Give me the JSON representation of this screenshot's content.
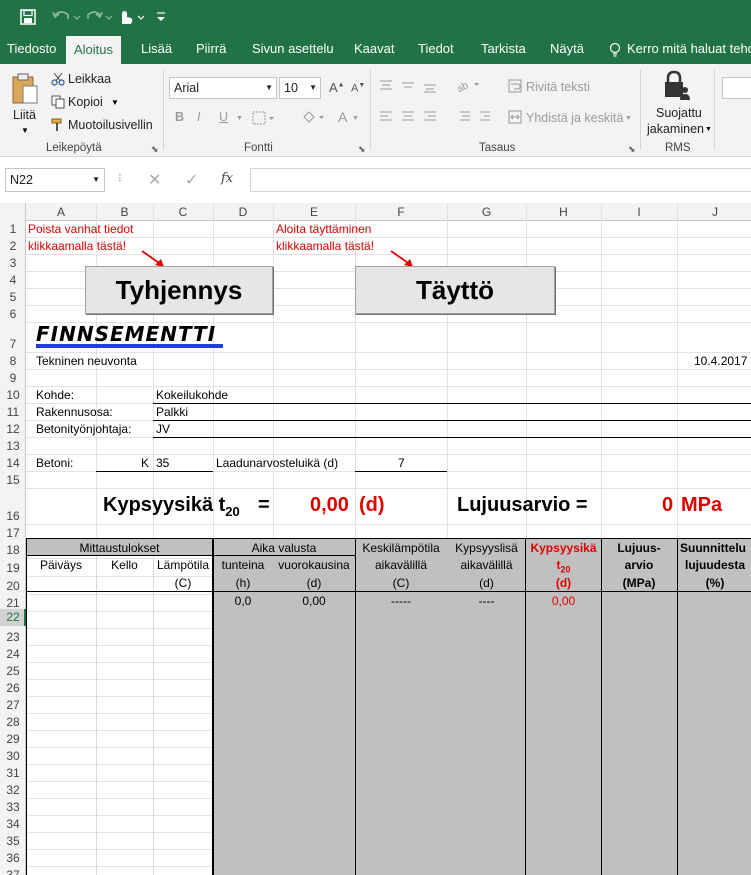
{
  "qat": {
    "save_icon": "save-icon",
    "undo_icon": "undo-icon",
    "redo_icon": "redo-icon",
    "touch_icon": "touch-mode-icon",
    "customize_icon": "customize-qat-icon"
  },
  "tabs": [
    "Tiedosto",
    "Aloitus",
    "Lisää",
    "Piirrä",
    "Sivun asettelu",
    "Kaavat",
    "Tiedot",
    "Tarkista",
    "Näytä",
    "Kerro mitä haluat tehdä"
  ],
  "ribbon": {
    "clipboard": {
      "paste": "Liitä",
      "cut": "Leikkaa",
      "copy": "Kopioi",
      "format_painter": "Muotoilusivellin",
      "group": "Leikepöytä"
    },
    "font": {
      "name": "Arial",
      "size": "10",
      "group": "Fontti",
      "bold": "B",
      "italic": "I",
      "underline": "U"
    },
    "alignment": {
      "wrap": "Rivitä teksti",
      "merge": "Yhdistä ja keskitä",
      "group": "Tasaus"
    },
    "rms": {
      "protect_line1": "Suojattu",
      "protect_line2": "jakaminen",
      "group": "RMS"
    }
  },
  "formula_bar": {
    "name_box": "N22",
    "fx": "fx",
    "cancel": "✕",
    "enter": "✓",
    "formula": ""
  },
  "columns": [
    "A",
    "B",
    "C",
    "D",
    "E",
    "F",
    "G",
    "H",
    "I",
    "J"
  ],
  "rows": [
    "1",
    "2",
    "3",
    "4",
    "5",
    "6",
    "7",
    "8",
    "9",
    "10",
    "11",
    "12",
    "13",
    "14",
    "15",
    "16",
    "17",
    "18",
    "19",
    "20",
    "21",
    "22",
    "23",
    "24",
    "25",
    "26",
    "27",
    "28",
    "29",
    "30",
    "31",
    "32",
    "33",
    "34",
    "35",
    "36",
    "37"
  ],
  "sheet": {
    "note1_l1": "Poista vanhat tiedot",
    "note1_l2": "klikkaamalla tästä!",
    "note2_l1": "Aloita täyttäminen",
    "note2_l2": "klikkaamalla tästä!",
    "btn_clear": "Tyhjennys",
    "btn_fill": "Täyttö",
    "logo": "FINNSEMENTTI",
    "dept": "Tekninen neuvonta",
    "date": "10.4.2017",
    "kohde_label": "Kohde:",
    "kohde_value": "Kokeilukohde",
    "rakennusosa_label": "Rakennusosa:",
    "rakennusosa_value": "Palkki",
    "johtaja_label": "Betonityönjohtaja:",
    "johtaja_value": "JV",
    "betoni_label": "Betoni:",
    "betoni_k": "K",
    "betoni_value": "35",
    "laatu_label": "Laadunarvosteluikä (d)",
    "laatu_value": "7",
    "kyps_label": "Kypsyysikä t",
    "kyps_sub": "20",
    "kyps_eq": "=",
    "kyps_value": "0,00",
    "kyps_unit": "(d)",
    "luj_label": "Lujuusarvio =",
    "luj_value": "0",
    "luj_unit": "MPa",
    "h_mittaus": "Mittaustulokset",
    "h_paivays": "Päiväys",
    "h_kello": "Kello",
    "h_lampotila": "Lämpötila",
    "h_c": "(C)",
    "h_aika": "Aika valusta",
    "h_tunteina": "tunteina",
    "h_h": "(h)",
    "h_vuoro": "vuorokausina",
    "h_d": "(d)",
    "h_keski1": "Keskilämpötila",
    "h_keski2": "aikavälillä",
    "h_keski3": "(C)",
    "h_lisa1": "Kypsyyslisä",
    "h_lisa2": "aikavälillä",
    "h_lisa3": "(d)",
    "h_kik1": "Kypsyysikä",
    "h_kik2": "t",
    "h_kik2sub": "20",
    "h_kik3": "(d)",
    "h_luj1": "Lujuus-",
    "h_luj2": "arvio",
    "h_luj3": "(MPa)",
    "h_suun1": "Suunnittelu",
    "h_suun2": "lujuudesta",
    "h_suun3": "(%)",
    "r21_tunt": "0,0",
    "r21_vrk": "0,00",
    "r21_keski": "-----",
    "r21_lisa": "----",
    "r21_kik": "0,00"
  },
  "colors": {
    "excel_green": "#217346",
    "red": "#e00000",
    "gray_fill": "#c0c0c0"
  }
}
